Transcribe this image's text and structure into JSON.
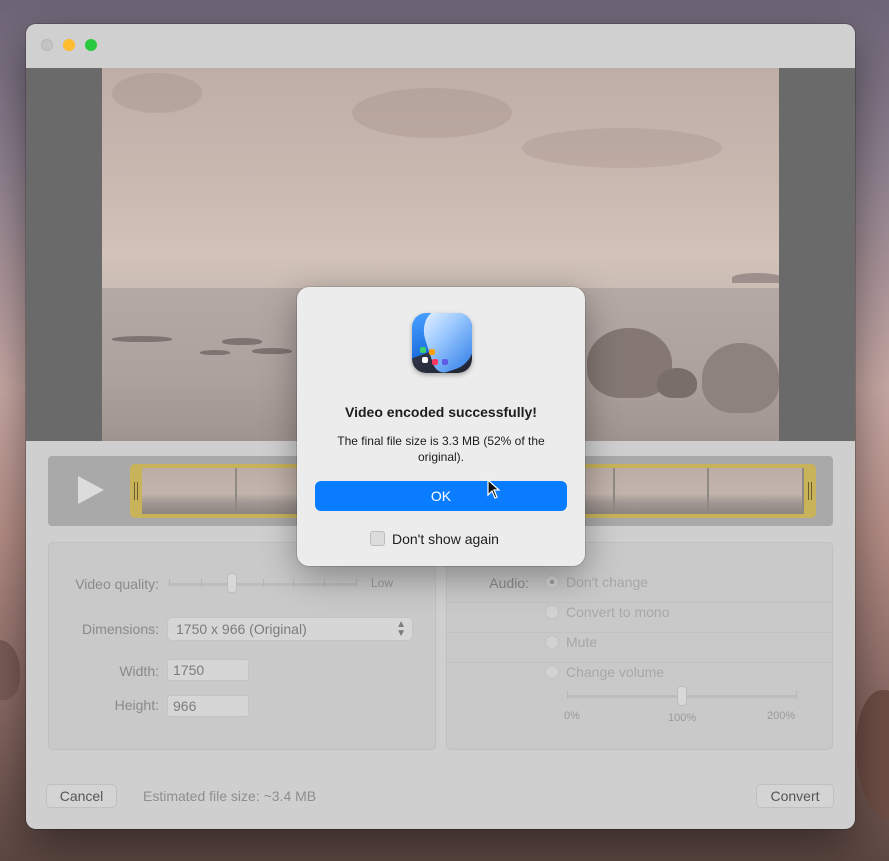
{
  "window": {
    "traffic_lights": [
      "close",
      "minimize",
      "maximize"
    ]
  },
  "controls": {
    "video_quality_label": "Video quality:",
    "quality_low_label": "Low",
    "quality_level": 0.35,
    "dimensions_label": "Dimensions:",
    "dimensions_value": "1750 x 966  (Original)",
    "width_label": "Width:",
    "width_value": "1750",
    "height_label": "Height:",
    "height_value": "966"
  },
  "audio": {
    "label": "Audio:",
    "options": [
      "Don't change",
      "Convert to mono",
      "Mute",
      "Change volume"
    ],
    "selected": "Don't change",
    "volume_ticks": [
      "0%",
      "100%",
      "200%"
    ],
    "volume_level": 0.5
  },
  "footer": {
    "cancel_label": "Cancel",
    "estimate_text": "Estimated file size: ~3.4 MB",
    "convert_label": "Convert"
  },
  "dialog": {
    "title": "Video encoded successfully!",
    "message": "The final file size is 3.3 MB (52% of the original).",
    "ok_label": "OK",
    "checkbox_label": "Don't show again",
    "checkbox_checked": false
  },
  "icons": [
    "play-icon",
    "app-icon",
    "popup-arrows-icon",
    "pointer-cursor-icon"
  ],
  "colors": {
    "accent": "#0a7cff",
    "trim_handle": "#c9b35a"
  }
}
